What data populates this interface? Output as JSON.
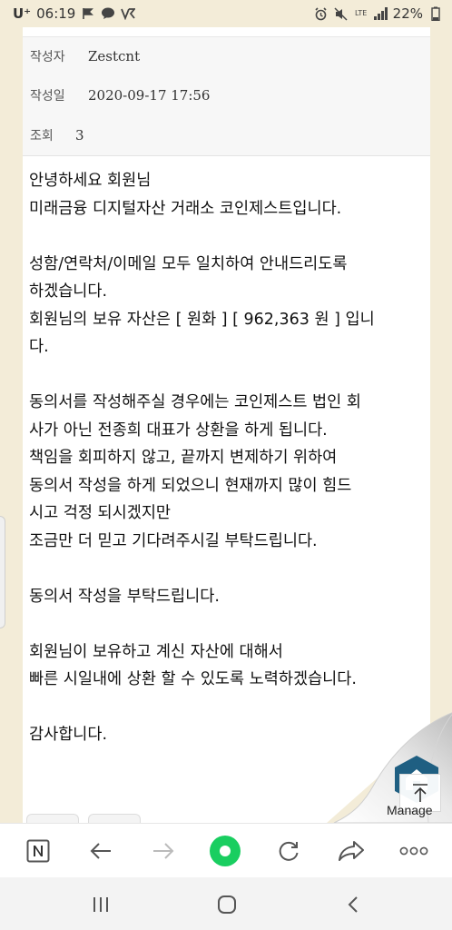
{
  "status_bar": {
    "carrier": "U⁺",
    "time": "06:19",
    "network": "LTE",
    "battery": "22%"
  },
  "meta": {
    "author_label": "작성자",
    "author": "Zestcnt",
    "date_label": "작성일",
    "date": "2020-09-17 17:56",
    "views_label": "조회",
    "views": "3"
  },
  "article": {
    "lines": [
      "안녕하세요 회원님",
      "미래금융 디지털자산 거래소 코인제스트입니다.",
      "",
      "성함/연락처/이메일 모두 일치하여 안내드리도록",
      "하겠습니다.",
      "회원님의 보유 자산은 [ 원화 ] [ 962,363 원 ] 입니",
      "다.",
      "",
      "동의서를 작성해주실 경우에는 코인제스트 법인 회",
      "사가 아닌 전종희 대표가 상환을 하게 됩니다.",
      "책임을 회피하지 않고, 끝까지 변제하기 위하여",
      "동의서 작성을 하게 되었으니 현재까지 많이 힘드",
      "시고 걱정 되시겠지만",
      "조금만 더 믿고 기다려주시길 부탁드립니다.",
      "",
      "동의서 작성을 부탁드립니다.",
      "",
      "회원님이 보유하고 계신 자산에 대해서",
      "빠른 시일내에 상환 할 수 있도록 노력하겠습니다.",
      "",
      "감사합니다."
    ]
  },
  "overlay": {
    "manage_label": "Manage"
  },
  "colors": {
    "background": "#f3ecd8",
    "accent_green": "#19ce60",
    "icon_gray": "#666666"
  }
}
